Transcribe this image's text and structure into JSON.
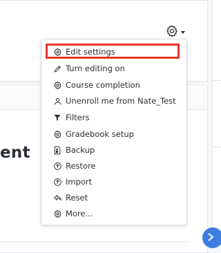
{
  "page": {
    "heading_fragment": "ent"
  },
  "menu": {
    "items": [
      {
        "label": "Edit settings",
        "icon": "gear-icon"
      },
      {
        "label": "Turn editing on",
        "icon": "pencil-icon"
      },
      {
        "label": "Course completion",
        "icon": "gear-icon"
      },
      {
        "label": "Unenroll me from Nate_Test",
        "icon": "user-icon"
      },
      {
        "label": "Filters",
        "icon": "filter-icon"
      },
      {
        "label": "Gradebook setup",
        "icon": "gear-icon"
      },
      {
        "label": "Backup",
        "icon": "backup-file-icon"
      },
      {
        "label": "Restore",
        "icon": "upload-circle-icon"
      },
      {
        "label": "Import",
        "icon": "upload-circle-icon"
      },
      {
        "label": "Reset",
        "icon": "reply-arrow-icon"
      },
      {
        "label": "More...",
        "icon": "gear-icon"
      }
    ]
  },
  "colors": {
    "highlight": "#e8352b",
    "accent_button": "#3d7fe0"
  }
}
